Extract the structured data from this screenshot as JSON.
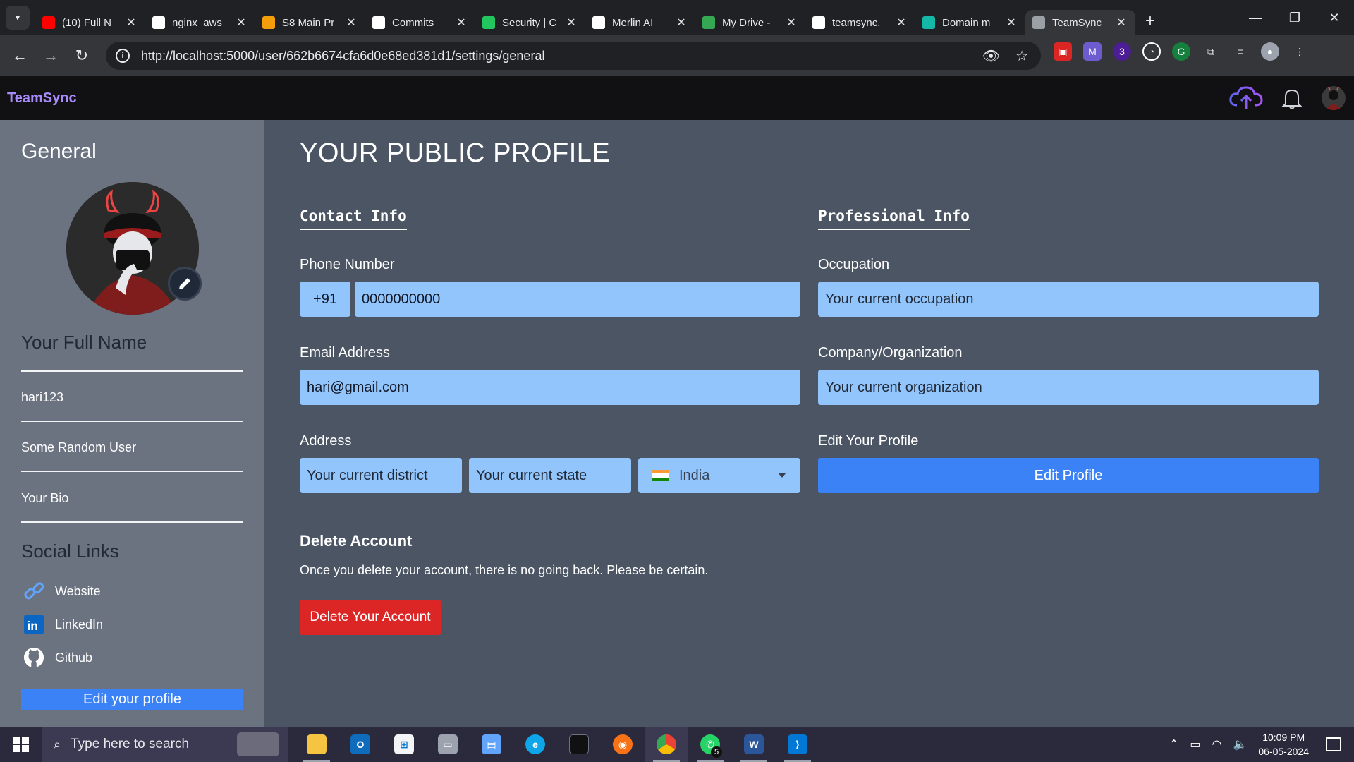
{
  "browser": {
    "tabs": [
      {
        "title": "(10) Full N",
        "favicon_color": "#ff0000",
        "favicon": "youtube-icon"
      },
      {
        "title": "nginx_aws",
        "favicon_color": "#ffffff",
        "favicon": "github-icon"
      },
      {
        "title": "S8 Main Pr",
        "favicon_color": "#f59e0b",
        "favicon": "firebase-icon"
      },
      {
        "title": "Commits",
        "favicon_color": "#ffffff",
        "favicon": "github-icon"
      },
      {
        "title": "Security | C",
        "favicon_color": "#22c55e",
        "favicon": "mongodb-icon"
      },
      {
        "title": "Merlin AI",
        "favicon_color": "#ffffff",
        "favicon": "merlin-icon"
      },
      {
        "title": "My Drive -",
        "favicon_color": "#34a853",
        "favicon": "drive-icon"
      },
      {
        "title": "teamsync.",
        "favicon_color": "#ffffff",
        "favicon": "namecheap-icon"
      },
      {
        "title": "Domain m",
        "favicon_color": "#14b8a6",
        "favicon": "domain-icon"
      },
      {
        "title": "TeamSync",
        "favicon_color": "#9aa0a6",
        "favicon": "globe-icon"
      }
    ],
    "url": "http://localhost:5000/user/662b6674cfa6d0e68ed381d1/settings/general"
  },
  "header": {
    "brand": "TeamSync"
  },
  "sidebar": {
    "title": "General",
    "full_name_label": "Your Full Name",
    "username": "hari123",
    "tagline": "Some Random User",
    "bio": "Your Bio",
    "social_title": "Social Links",
    "social_links": [
      {
        "label": "Website",
        "icon": "link-icon"
      },
      {
        "label": "LinkedIn",
        "icon": "linkedin-icon"
      },
      {
        "label": "Github",
        "icon": "github-icon"
      }
    ],
    "edit_button": "Edit your profile"
  },
  "main": {
    "title": "YOUR PUBLIC PROFILE",
    "contact": {
      "heading": "Contact Info",
      "phone_label": "Phone Number",
      "country_code": "+91",
      "phone_value": "0000000000",
      "email_label": "Email Address",
      "email_value": "hari@gmail.com",
      "address_label": "Address",
      "district_placeholder": "Your current district",
      "state_placeholder": "Your current state",
      "country_value": "India"
    },
    "professional": {
      "heading": "Professional Info",
      "occupation_label": "Occupation",
      "occupation_placeholder": "Your current occupation",
      "company_label": "Company/Organization",
      "company_placeholder": "Your current organization",
      "edit_label": "Edit Your Profile",
      "edit_button": "Edit Profile"
    },
    "delete": {
      "title": "Delete Account",
      "text": "Once you delete your account, there is no going back. Please be certain.",
      "button": "Delete Your Account"
    }
  },
  "taskbar": {
    "search_placeholder": "Type here to search",
    "time": "10:09 PM",
    "date": "06-05-2024",
    "whatsapp_badge": "5"
  },
  "colors": {
    "accent": "#3b82f6",
    "danger": "#dc2626",
    "input_bg": "#93c5fd",
    "brand": "#a78bfa"
  }
}
